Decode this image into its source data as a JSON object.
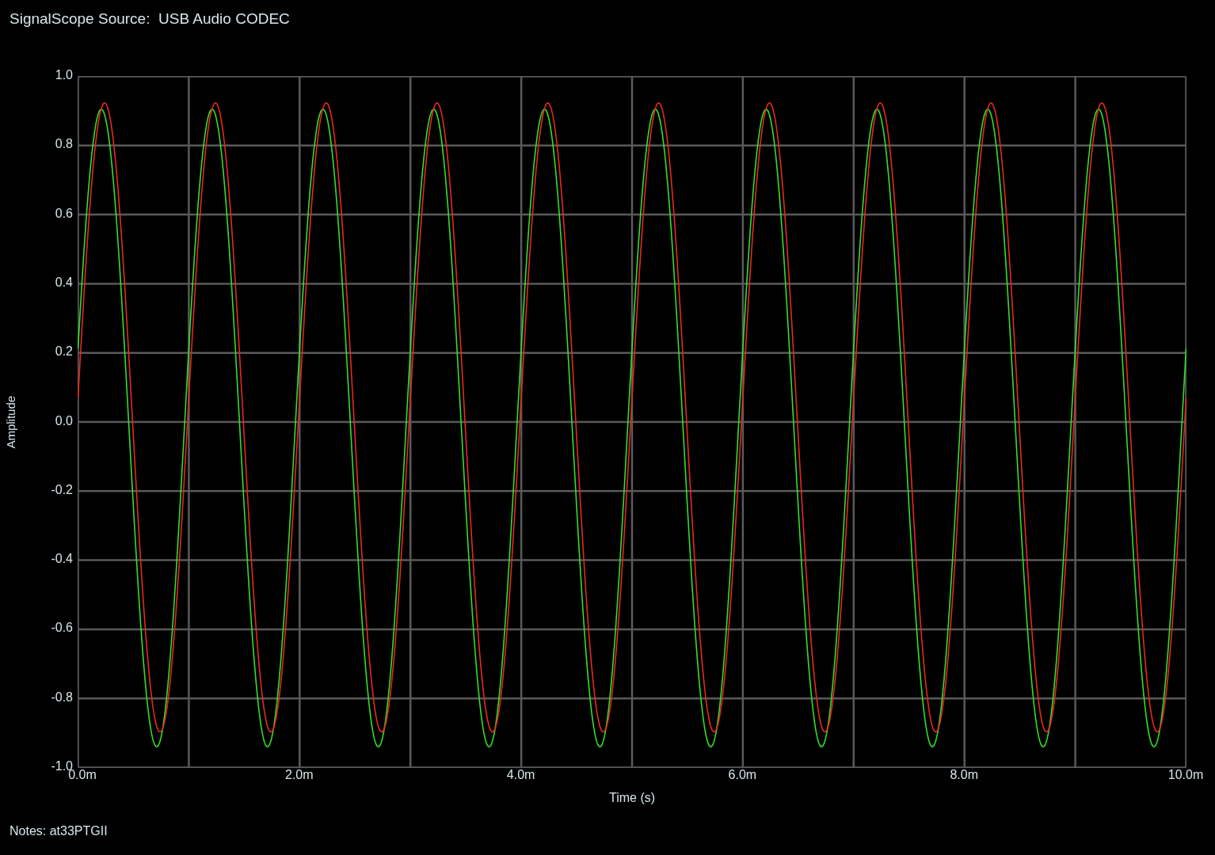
{
  "title": "SignalScope Source:  USB Audio CODEC",
  "plot": {
    "ylabel": "Amplitude",
    "xlabel": "Time (s)",
    "yticks": [
      "1.0",
      "0.8",
      "0.6",
      "0.4",
      "0.2",
      "0.0",
      "-0.2",
      "-0.4",
      "-0.6",
      "-0.8",
      "-1.0"
    ],
    "xticks": [
      "0.0m",
      "2.0m",
      "4.0m",
      "6.0m",
      "8.0m",
      "10.0m"
    ]
  },
  "notes": "Notes: at33PTGII"
}
